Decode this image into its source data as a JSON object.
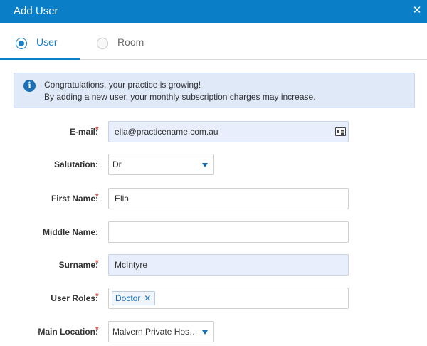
{
  "dialog": {
    "title": "Add User",
    "close_icon": "close-icon"
  },
  "tabs": [
    {
      "label": "User",
      "selected": true
    },
    {
      "label": "Room",
      "selected": false
    }
  ],
  "banner": {
    "icon": "info-icon",
    "line1": "Congratulations, your practice is growing!",
    "line2": "By adding a new user, your monthly subscription charges may increase."
  },
  "form": {
    "email": {
      "label": "E-mail:",
      "required": true,
      "value": "ella@practicename.com.au",
      "icon": "contact-card-icon"
    },
    "salutation": {
      "label": "Salutation:",
      "required": false,
      "value": "Dr"
    },
    "first_name": {
      "label": "First Name:",
      "required": true,
      "value": "Ella"
    },
    "middle_name": {
      "label": "Middle Name:",
      "required": false,
      "value": ""
    },
    "surname": {
      "label": "Surname:",
      "required": true,
      "value": "McIntyre"
    },
    "user_roles": {
      "label": "User Roles:",
      "required": true,
      "chips": [
        "Doctor"
      ]
    },
    "main_location": {
      "label": "Main Location:",
      "required": true,
      "value": "Malvern Private Hos…"
    }
  },
  "colors": {
    "accent": "#0a7fc8",
    "banner_bg": "#dfe9f8",
    "required": "#d9534f"
  }
}
